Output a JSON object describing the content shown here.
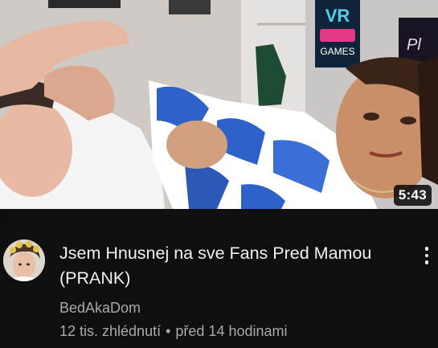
{
  "video": {
    "duration": "5:43",
    "title": "Jsem Hnusnej na sve Fans Pred Mamou (PRANK)",
    "channel": "BedAkaDom",
    "views": "12 tis. zhlédnutí",
    "separator": "•",
    "age": "před 14 hodinami"
  },
  "thumbnail_text": {
    "vr_logo_top": "VR",
    "vr_logo_bottom": "GAMES",
    "poster_right": "Pl"
  },
  "icons": {
    "more": "vertical-ellipsis-icon"
  },
  "colors": {
    "background": "#0f0f0f",
    "title": "#f1f1f1",
    "secondary_text": "#aaaaaa",
    "duration_badge": "#000000"
  }
}
